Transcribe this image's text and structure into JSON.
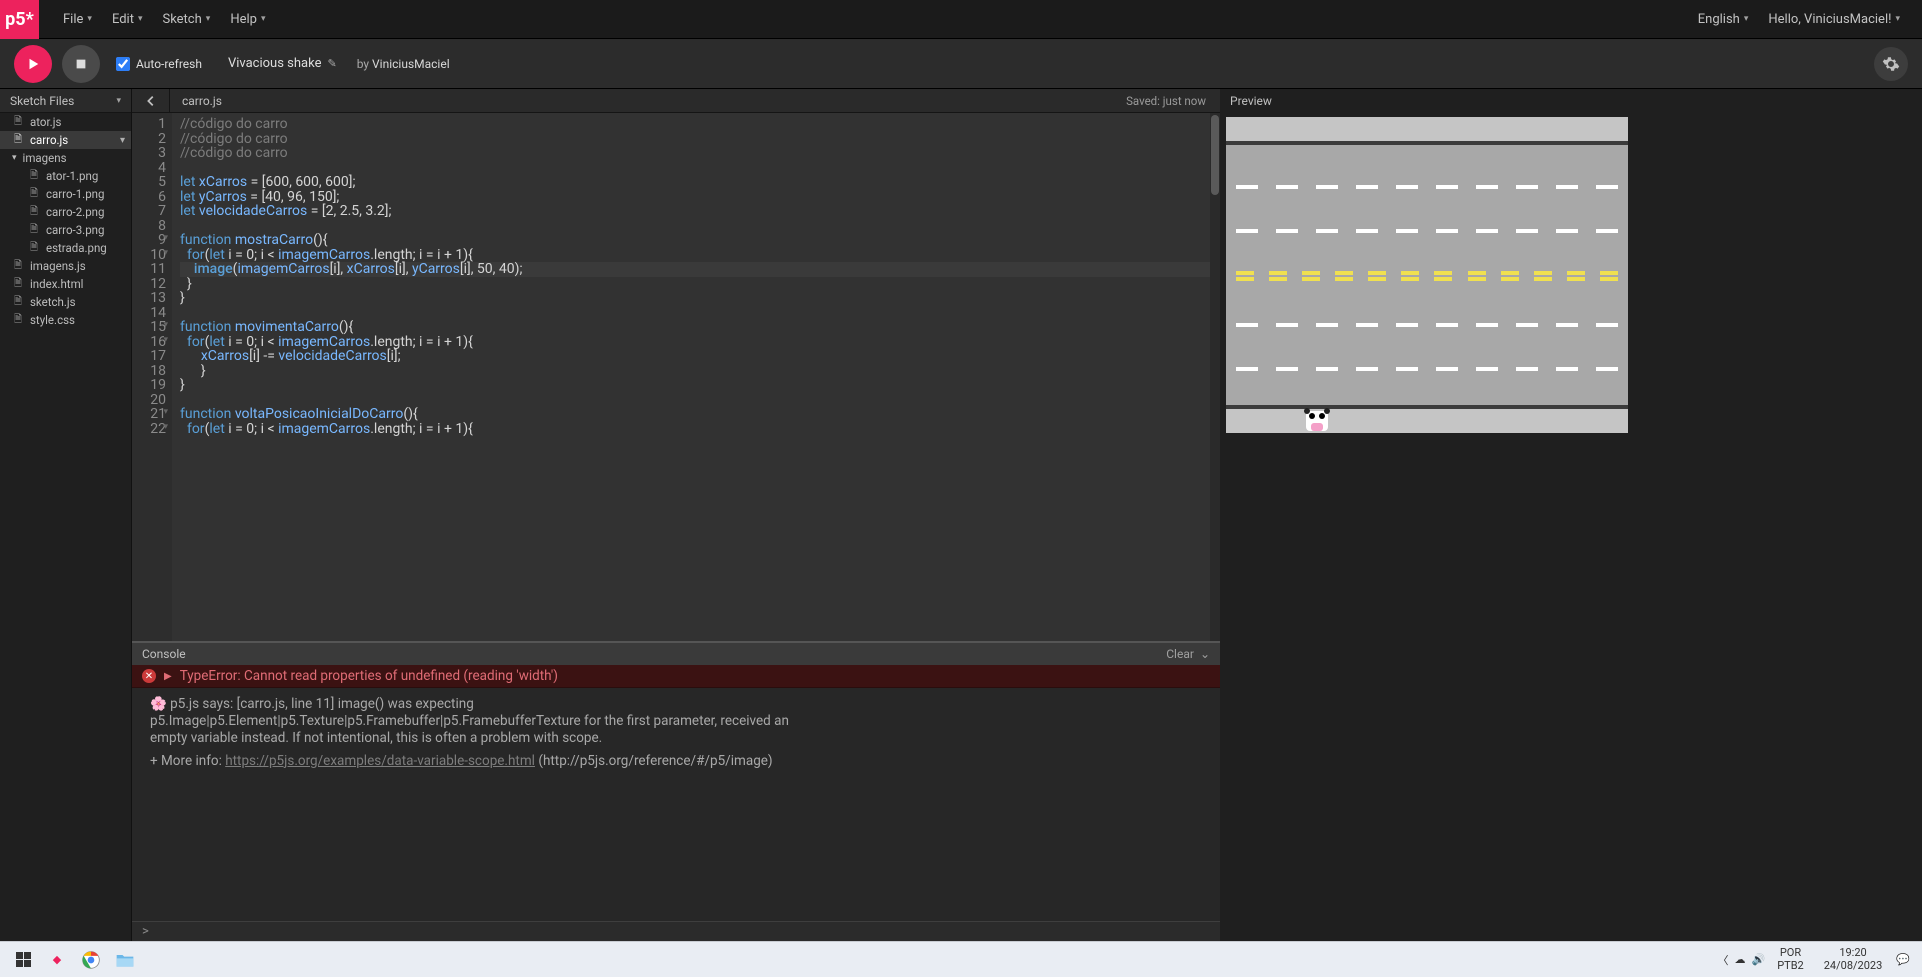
{
  "header": {
    "logo": "p5*",
    "menus": [
      "File",
      "Edit",
      "Sketch",
      "Help"
    ],
    "language": "English",
    "greeting": "Hello, ViniciusMaciel!"
  },
  "toolbar": {
    "auto_refresh_label": "Auto-refresh",
    "auto_refresh_checked": true,
    "sketch_name": "Vivacious shake",
    "by_label": "by",
    "author": "ViniciusMaciel"
  },
  "sidebar": {
    "title": "Sketch Files",
    "files": [
      {
        "name": "ator.js",
        "depth": 0,
        "icon": "file"
      },
      {
        "name": "carro.js",
        "depth": 0,
        "icon": "file",
        "selected": true,
        "chev": true
      },
      {
        "name": "imagens",
        "depth": 0,
        "icon": "folder"
      },
      {
        "name": "ator-1.png",
        "depth": 1,
        "icon": "file"
      },
      {
        "name": "carro-1.png",
        "depth": 1,
        "icon": "file"
      },
      {
        "name": "carro-2.png",
        "depth": 1,
        "icon": "file"
      },
      {
        "name": "carro-3.png",
        "depth": 1,
        "icon": "file"
      },
      {
        "name": "estrada.png",
        "depth": 1,
        "icon": "file"
      },
      {
        "name": "imagens.js",
        "depth": 0,
        "icon": "file"
      },
      {
        "name": "index.html",
        "depth": 0,
        "icon": "file"
      },
      {
        "name": "sketch.js",
        "depth": 0,
        "icon": "file"
      },
      {
        "name": "style.css",
        "depth": 0,
        "icon": "file"
      }
    ]
  },
  "editor": {
    "current_file": "carro.js",
    "save_status": "Saved: just now",
    "highlighted_line": 11,
    "code_lines": [
      "//código do carro",
      "//código do carro",
      "//código do carro",
      "",
      "let xCarros = [600, 600, 600];",
      "let yCarros = [40, 96, 150];",
      "let velocidadeCarros = [2, 2.5, 3.2];",
      "",
      "function mostraCarro(){",
      "  for(let i = 0; i < imagemCarros.length; i = i + 1){",
      "    image(imagemCarros[i], xCarros[i], yCarros[i], 50, 40);",
      "  }",
      "}",
      "",
      "function movimentaCarro(){",
      "  for(let i = 0; i < imagemCarros.length; i = i + 1){",
      "      xCarros[i] -= velocidadeCarros[i];",
      "      }",
      "}",
      "",
      "function voltaPosicaoInicialDoCarro(){",
      "  for(let i = 0; i < imagemCarros.length; i = i + 1){"
    ]
  },
  "console": {
    "title": "Console",
    "clear_label": "Clear",
    "error": "TypeError: Cannot read properties of undefined (reading 'width')",
    "info_line1": "🌸 p5.js says: [carro.js, line 11] image() was expecting p5.Image|p5.Element|p5.Texture|p5.Framebuffer|p5.FramebufferTexture for the first parameter, received an empty variable instead. If not intentional, this is often a problem with scope.",
    "info_line2a": "+ More info: ",
    "info_link": "https://p5js.org/examples/data-variable-scope.html",
    "info_line2b": " (http://p5js.org/reference/#/p5/image)",
    "prompt": ">"
  },
  "preview": {
    "title": "Preview"
  },
  "taskbar": {
    "lang_top": "POR",
    "lang_bot": "PTB2",
    "time": "19:20",
    "date": "24/08/2023"
  }
}
